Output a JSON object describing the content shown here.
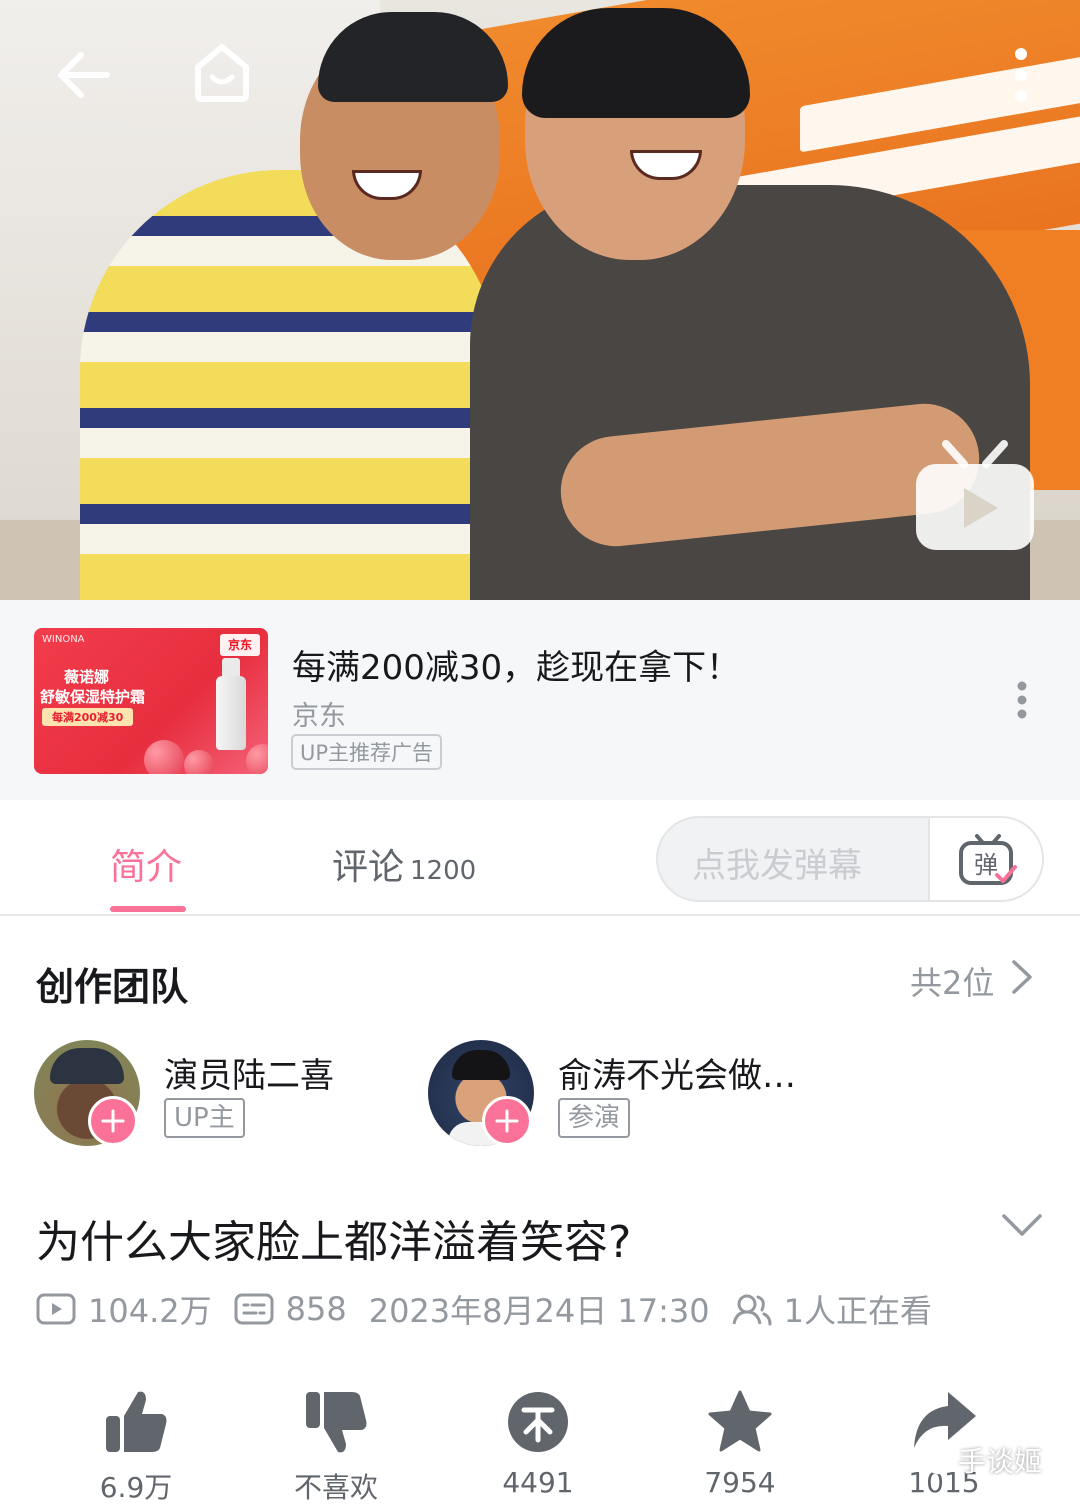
{
  "top_bar": {
    "back_icon": "back-arrow-icon",
    "home_icon": "home-icon",
    "more_icon": "more-vertical-icon"
  },
  "ad": {
    "thumbnail_brand": "WINONA",
    "thumbnail_store": "京东",
    "thumbnail_line1": "薇诺娜",
    "thumbnail_line2": "舒敏保湿特护霜",
    "thumbnail_line3": "每满200减30",
    "title": "每满200减30，趁现在拿下！",
    "source": "京东",
    "tag": "UP主推荐广告"
  },
  "tabs": {
    "intro": "简介",
    "comments": "评论",
    "comments_count": "1200",
    "danmaku_placeholder": "点我发弹幕",
    "danmaku_button": "弹"
  },
  "creators": {
    "title": "创作团队",
    "count": "共2位",
    "members": [
      {
        "name": "演员陆二喜",
        "role": "UP主"
      },
      {
        "name": "俞涛不光会做…",
        "role": "参演"
      }
    ]
  },
  "video": {
    "title": "为什么大家脸上都洋溢着笑容?",
    "views": "104.2万",
    "danmaku": "858",
    "date": "2023年8月24日 17:30",
    "watching": "1人正在看"
  },
  "actions": {
    "like": "6.9万",
    "dislike": "不喜欢",
    "coin": "4491",
    "favorite": "7954",
    "share": "1015"
  },
  "watermark": "手谈姬",
  "colors": {
    "accent": "#fb7299",
    "text_primary": "#18191c",
    "text_secondary": "#9499a0"
  }
}
